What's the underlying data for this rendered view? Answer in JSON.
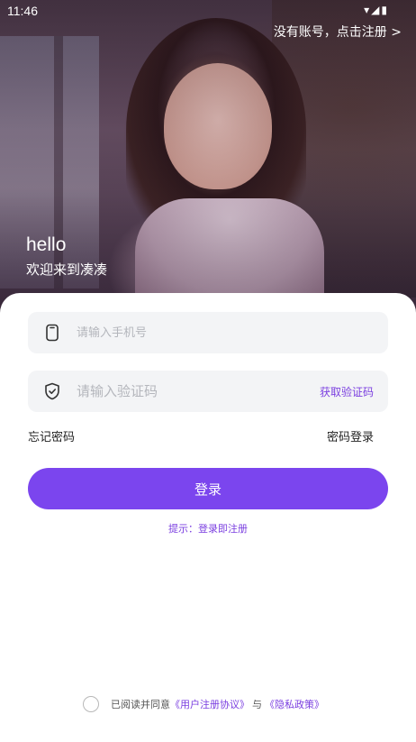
{
  "status_bar": {
    "time": "11:46",
    "icons": [
      "wifi-icon",
      "signal-icon",
      "battery-icon"
    ]
  },
  "header": {
    "register_link": "没有账号，点击注册 >"
  },
  "greeting": {
    "hello": "hello",
    "welcome": "欢迎来到凑凑"
  },
  "form": {
    "phone_placeholder": "请输入手机号",
    "code_placeholder": "请输入验证码",
    "get_code_label": "获取验证码",
    "forgot_password": "忘记密码",
    "password_login": "密码登录",
    "login_button": "登录",
    "tip": "提示：登录即注册"
  },
  "agreement": {
    "prefix": "已阅读并同意",
    "user_agreement": "《用户注册协议》",
    "and": "与",
    "privacy_policy": "《隐私政策》"
  },
  "colors": {
    "accent": "#7b45ee",
    "accent_text": "#7b3fe0",
    "field_bg": "#f3f4f6"
  }
}
